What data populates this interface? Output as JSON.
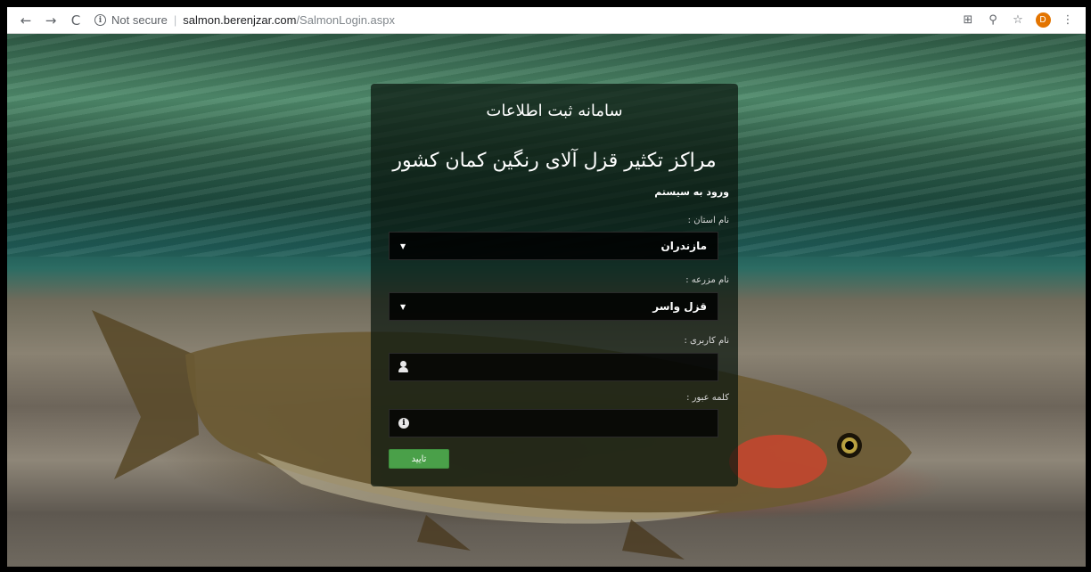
{
  "browser": {
    "security_label": "Not secure",
    "separator": "|",
    "url_host": "salmon.berenjzar.com",
    "url_path": "/SalmonLogin.aspx",
    "profile_initial": "D",
    "back_glyph": "←",
    "forward_glyph": "→",
    "reload_glyph": "C",
    "info_glyph": "i",
    "translate_glyph": "⊞",
    "zoom_glyph": "⚲",
    "star_glyph": "☆",
    "menu_glyph": "⋮"
  },
  "panel": {
    "system_title": "سامانه ثبت اطلاعات",
    "subtitle": "مراکز تکثیر قزل آلای رنگین کمان کشور",
    "login_heading": "ورود به سیستم",
    "province": {
      "label": "نام استان :",
      "selected": "مازندران"
    },
    "farm": {
      "label": "نام مزرعه :",
      "selected": "قزل واسر"
    },
    "username": {
      "label": "نام کاربری :",
      "value": ""
    },
    "password": {
      "label": "کلمه عبور :",
      "value": ""
    },
    "submit_label": "تایید",
    "dropdown_arrow": "▼",
    "info_glyph": "i"
  },
  "colors": {
    "panel_bg": "rgba(10,22,14,0.72)",
    "button_green": "#4aa049",
    "profile_orange": "#e37400"
  }
}
